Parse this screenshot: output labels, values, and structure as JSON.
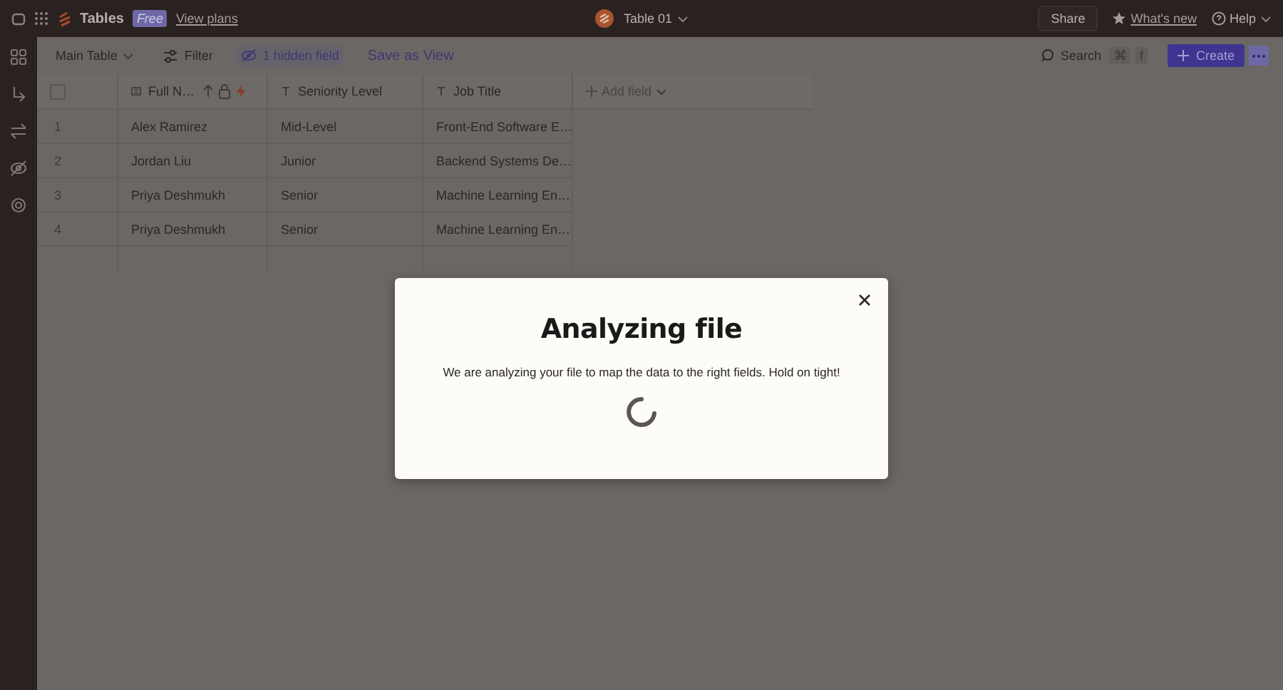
{
  "topbar": {
    "app_name": "Tables",
    "plan_badge": "Free",
    "plans_link": "View plans",
    "table_title": "Table 01",
    "share": "Share",
    "whats_new": "What's new",
    "help": "Help"
  },
  "toolbar": {
    "view": "Main Table",
    "filter": "Filter",
    "hidden_fields": "1 hidden field",
    "save_view": "Save as View",
    "search": "Search",
    "shortcut": [
      "⌘",
      "f"
    ],
    "create": "Create"
  },
  "table": {
    "select_all": {
      "checked": false
    },
    "columns": [
      {
        "label": "Full N…",
        "kind": "primary"
      },
      {
        "label": "Seniority Level",
        "kind": "text"
      },
      {
        "label": "Job Title",
        "kind": "text"
      }
    ],
    "add_field": "Add field",
    "rows": [
      {
        "number": "1",
        "cells": [
          "Alex Ramirez",
          "Mid-Level",
          "Front-End Software E…"
        ]
      },
      {
        "number": "2",
        "cells": [
          "Jordan Liu",
          "Junior",
          "Backend Systems De…"
        ]
      },
      {
        "number": "3",
        "cells": [
          "Priya Deshmukh",
          "Senior",
          "Machine Learning En…"
        ]
      },
      {
        "number": "4",
        "cells": [
          "Priya Deshmukh",
          "Senior",
          "Machine Learning En…"
        ]
      }
    ]
  },
  "modal": {
    "title": "Analyzing file",
    "message": "We are analyzing your file to map the data to the right fields. Hold on tight!",
    "loading": true
  }
}
